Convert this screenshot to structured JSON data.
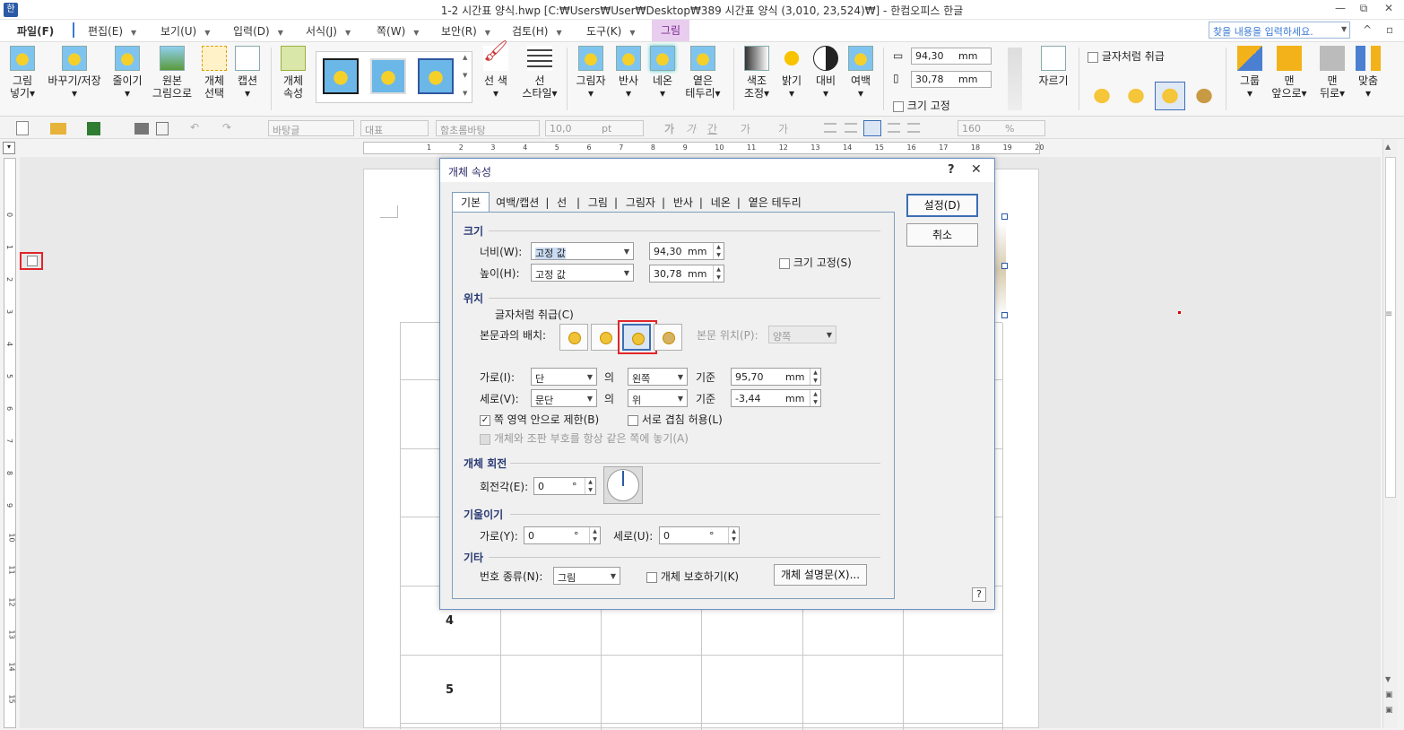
{
  "window": {
    "title": "1-2 시간표 양식.hwp [C:₩Users₩User₩Desktop₩389 시간표 양식 (3,010, 23,524)₩] - 한컴오피스 한글",
    "controls": [
      "—",
      "⧉",
      "✕"
    ],
    "app_icon": "hwp-app-icon"
  },
  "menubar": {
    "items": [
      "파일(F)",
      "편집(E)",
      "보기(U)",
      "입력(D)",
      "서식(J)",
      "쪽(W)",
      "보안(R)",
      "검토(H)",
      "도구(K)",
      "그림"
    ],
    "search_placeholder": "찾을 내용을 입력하세요.",
    "right_icons": [
      "^",
      "▫"
    ]
  },
  "ribbon": {
    "buttons": [
      {
        "label1": "그림",
        "label2": "넣기▾"
      },
      {
        "label1": "바꾸기/저장",
        "label2": "▾"
      },
      {
        "label1": "줄이기",
        "label2": "▾"
      },
      {
        "label1": "원본",
        "label2": "그림으로"
      },
      {
        "label1": "개체",
        "label2": "선택"
      },
      {
        "label1": "캡션",
        "label2": "▾"
      },
      {
        "label1": "개체",
        "label2": "속성"
      }
    ],
    "line_color": "선 색",
    "line_style1": "선",
    "line_style2": "스타일▾",
    "effects": [
      {
        "label1": "그림자",
        "label2": "▾"
      },
      {
        "label1": "반사",
        "label2": "▾"
      },
      {
        "label1": "네온",
        "label2": "▾"
      },
      {
        "label1": "옅은",
        "label2": "테두리▾"
      }
    ],
    "adjust": [
      {
        "label1": "색조",
        "label2": "조정▾"
      },
      {
        "label1": "밝기",
        "label2": "▾"
      },
      {
        "label1": "대비",
        "label2": "▾"
      },
      {
        "label1": "여백",
        "label2": "▾"
      }
    ],
    "width_value": "94,30",
    "height_value": "30,78",
    "unit": "mm",
    "size_lock": "크기 고정",
    "crop": "자르기",
    "treat_as_char": "글자처럼 취급",
    "arrange": [
      {
        "label1": "그룹",
        "label2": "▾"
      },
      {
        "label1": "맨",
        "label2": "앞으로▾"
      },
      {
        "label1": "맨",
        "label2": "뒤로▾"
      },
      {
        "label1": "맞춤",
        "label2": "▾"
      }
    ]
  },
  "toolbar2": {
    "style": "바탕글",
    "lang": "대표",
    "font": "함초롬바탕",
    "size": "10,0",
    "size_unit": "pt",
    "zoom": "160",
    "zoom_unit": "%",
    "format_glyphs": [
      "가",
      "가",
      "간",
      "가",
      "가"
    ]
  },
  "ruler_h": {
    "numbers": [
      "1",
      "2",
      "3",
      "4",
      "5",
      "6",
      "7",
      "8",
      "9",
      "10",
      "11",
      "12",
      "13",
      "14",
      "15",
      "16",
      "17",
      "18",
      "19",
      "20"
    ]
  },
  "ruler_v": {
    "numbers": [
      "0",
      "1",
      "2",
      "3",
      "4",
      "5",
      "6",
      "7",
      "8",
      "9",
      "10",
      "11",
      "12",
      "13",
      "14",
      "15"
    ]
  },
  "document": {
    "rows": [
      "4",
      "5"
    ]
  },
  "dialog": {
    "title": "개체 속성",
    "help": "?",
    "close": "✕",
    "tabs": [
      "기본",
      "여백/캡션",
      "선",
      "그림",
      "그림자",
      "반사",
      "네온",
      "옅은 테두리"
    ],
    "ok": "설정(D)",
    "cancel": "취소",
    "size": {
      "heading": "크기",
      "width_label": "너비(W):",
      "width_mode": "고정 값",
      "width_value": "94,30",
      "height_label": "높이(H):",
      "height_mode": "고정 값",
      "height_value": "30,78",
      "unit": "mm",
      "lock_label": "크기 고정(S)"
    },
    "position": {
      "heading": "위치",
      "treat_as_char": "글자처럼 취급(C)",
      "wrap_label": "본문과의 배치:",
      "text_pos_label": "본문 위치(P):",
      "text_pos_value": "양쪽",
      "horiz_label": "가로(I):",
      "horiz_base": "단",
      "of": "의",
      "horiz_align": "왼쪽",
      "basis": "기준",
      "horiz_value": "95,70",
      "vert_label": "세로(V):",
      "vert_base": "문단",
      "vert_align": "위",
      "vert_value": "-3,44",
      "unit": "mm",
      "limit_page": "쪽 영역 안으로 제한(B)",
      "allow_overlap": "서로 겹침 허용(L)",
      "keep_anchor": "개체와 조판 부호를 항상 같은 쪽에 놓기(A)"
    },
    "rotation": {
      "heading": "개체 회전",
      "angle_label": "회전각(E):",
      "angle_value": "0",
      "deg": "°"
    },
    "skew": {
      "heading": "기울이기",
      "h_label": "가로(Y):",
      "h_value": "0",
      "v_label": "세로(U):",
      "v_value": "0",
      "deg": "°"
    },
    "other": {
      "heading": "기타",
      "num_label": "번호 종류(N):",
      "num_value": "그림",
      "protect": "개체 보호하기(K)",
      "desc_button": "개체 설명문(X)..."
    }
  },
  "colors": {
    "accent": "#3c6eb4",
    "highlight": "#e0262b",
    "tab_pic": "#e8cdef"
  }
}
